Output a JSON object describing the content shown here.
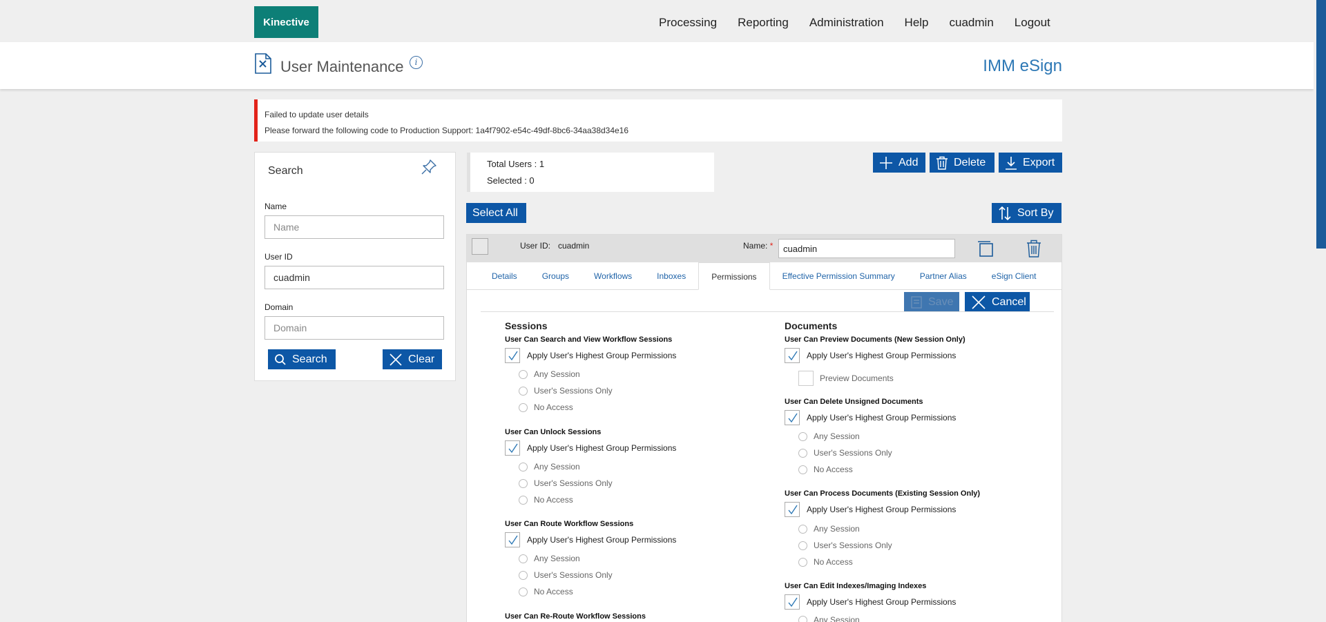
{
  "app": {
    "logo": "Kinective",
    "brand": "IMM eSign"
  },
  "nav": {
    "items": [
      "Processing",
      "Reporting",
      "Administration",
      "Help",
      "cuadmin",
      "Logout"
    ]
  },
  "page": {
    "title": "User Maintenance",
    "info_glyph": "i"
  },
  "alert": {
    "line1": "Failed to update user details",
    "line2": "Please forward the following code to Production Support: 1a4f7902-e54c-49df-8bc6-34aa38d34e16"
  },
  "search": {
    "title": "Search",
    "name_label": "Name",
    "name_placeholder": "Name",
    "name_value": "",
    "userid_label": "User ID",
    "userid_value": "cuadmin",
    "domain_label": "Domain",
    "domain_placeholder": "Domain",
    "domain_value": "",
    "search_button": "Search",
    "clear_button": "Clear"
  },
  "summary": {
    "total": "Total Users : 1",
    "selected": "Selected : 0"
  },
  "toolbar": {
    "add": "Add",
    "delete": "Delete",
    "export": "Export",
    "select_all": "Select All",
    "sort_by": "Sort By"
  },
  "user": {
    "userid_label": "User ID:",
    "userid_value": "cuadmin",
    "name_label": "Name:",
    "required_mark": "*",
    "name_value": "cuadmin"
  },
  "tabs": [
    "Details",
    "Groups",
    "Workflows",
    "Inboxes",
    "Permissions",
    "Effective Permission Summary",
    "Partner Alias",
    "eSign Client"
  ],
  "form_actions": {
    "save": "Save",
    "cancel": "Cancel"
  },
  "sessions": {
    "title": "Sessions",
    "groups": [
      {
        "heading": "User Can Search and View Workflow Sessions",
        "apply_label": "Apply User's Highest Group Permissions",
        "options": [
          "Any Session",
          "User's Sessions Only",
          "No Access"
        ]
      },
      {
        "heading": "User Can Unlock Sessions",
        "apply_label": "Apply User's Highest Group Permissions",
        "options": [
          "Any Session",
          "User's Sessions Only",
          "No Access"
        ]
      },
      {
        "heading": "User Can Route Workflow Sessions",
        "apply_label": "Apply User's Highest Group Permissions",
        "options": [
          "Any Session",
          "User's Sessions Only",
          "No Access"
        ]
      },
      {
        "heading": "User Can Re-Route Workflow Sessions"
      }
    ]
  },
  "documents": {
    "title": "Documents",
    "preview_heading": "User Can Preview Documents (New Session Only)",
    "preview_apply": "Apply User's Highest Group Permissions",
    "preview_option": "Preview Documents",
    "groups": [
      {
        "heading": "User Can Delete Unsigned Documents",
        "apply_label": "Apply User's Highest Group Permissions",
        "options": [
          "Any Session",
          "User's Sessions Only",
          "No Access"
        ]
      },
      {
        "heading": "User Can Process Documents (Existing Session Only)",
        "apply_label": "Apply User's Highest Group Permissions",
        "options": [
          "Any Session",
          "User's Sessions Only",
          "No Access"
        ]
      },
      {
        "heading": "User Can Edit Indexes/Imaging Indexes",
        "apply_label": "Apply User's Highest Group Permissions",
        "options": [
          "Any Session"
        ]
      }
    ]
  },
  "colors": {
    "primary": "#0d57a6",
    "logo_bg": "#0d7f77",
    "error": "#e2231a",
    "link": "#1f63a8",
    "brand": "#2d78b5"
  }
}
